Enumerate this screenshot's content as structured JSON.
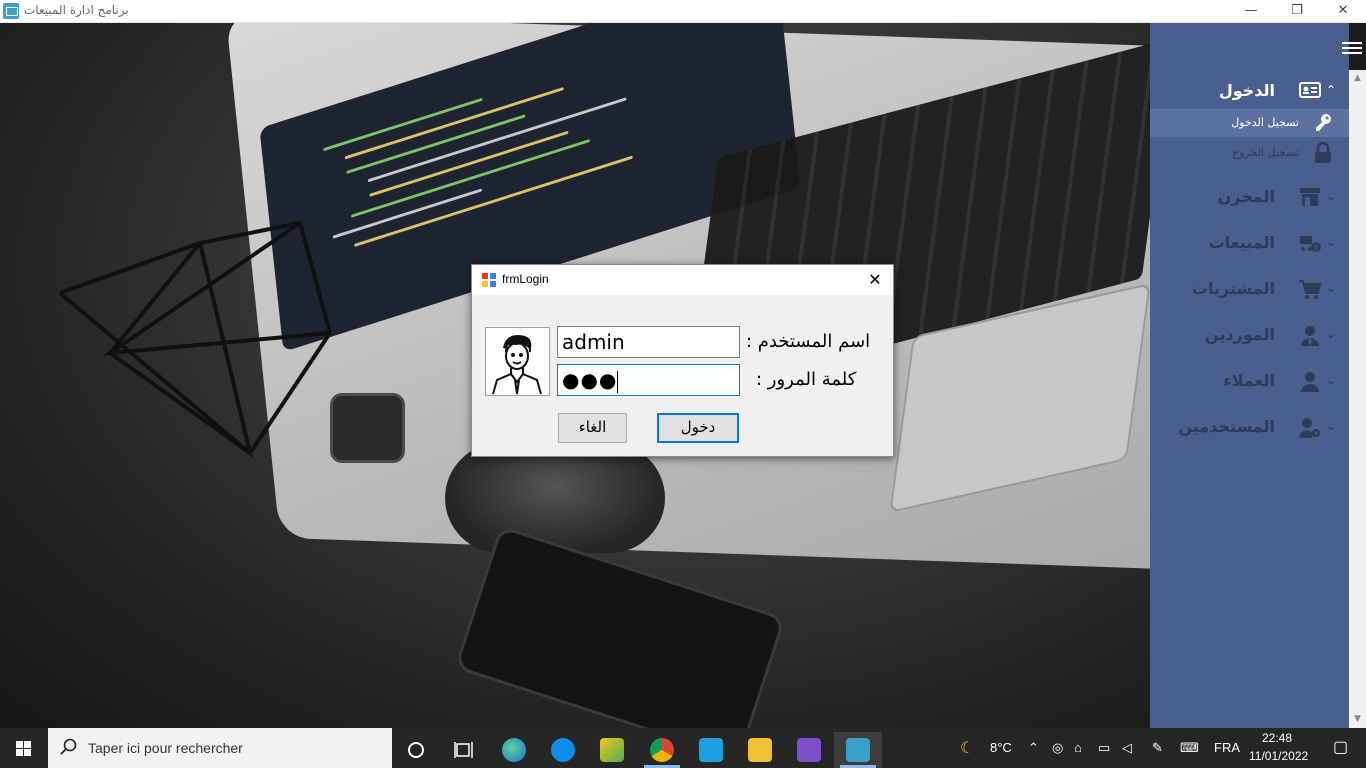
{
  "window": {
    "title": "برنامج ادارة المبيعات",
    "minimize_glyph": "—",
    "maximize_glyph": "❐",
    "close_glyph": "✕"
  },
  "sidebar": {
    "sections": [
      {
        "label": "الدخول",
        "icon": "id-card-icon",
        "expanded": true
      },
      {
        "label": "المخزن",
        "icon": "store-icon",
        "expanded": false
      },
      {
        "label": "المبيعات",
        "icon": "cart-dollar-icon",
        "expanded": false
      },
      {
        "label": "المشتريات",
        "icon": "cart-icon",
        "expanded": false
      },
      {
        "label": "الموردين",
        "icon": "user-tie-icon",
        "expanded": false
      },
      {
        "label": "العملاء",
        "icon": "user-icon",
        "expanded": false
      },
      {
        "label": "المستخدمين",
        "icon": "user-cog-icon",
        "expanded": false
      }
    ],
    "login_subitems": [
      {
        "label": "تسجيل الدخول",
        "icon": "key-icon",
        "selected": true
      },
      {
        "label": "تسجيل الخروج",
        "icon": "lock-icon",
        "selected": false
      }
    ],
    "chevron_up": "⌃",
    "chevron_down": "⌄"
  },
  "dialog": {
    "title": "frmLogin",
    "close_glyph": "✕",
    "username_label": "اسم المستخدم :",
    "password_label": "كلمة المرور :",
    "username_value": "admin",
    "password_mask": "●●●",
    "cancel_label": "الغاء",
    "login_label": "دخول"
  },
  "taskbar": {
    "search_placeholder": "Taper ici pour rechercher",
    "apps": [
      "cortana",
      "task-view",
      "edge",
      "teamviewer",
      "app-yellow",
      "chrome",
      "app-arrow",
      "file-explorer",
      "visual-studio",
      "sales-app"
    ],
    "temperature": "8°C",
    "language": "FRA",
    "time": "22:48",
    "date": "11/01/2022"
  },
  "colors": {
    "sidebar": "#4a5f8e",
    "sidebar_text_dim": "#2e3c5c",
    "accent": "#0078d7",
    "taskbar": "#262626"
  }
}
